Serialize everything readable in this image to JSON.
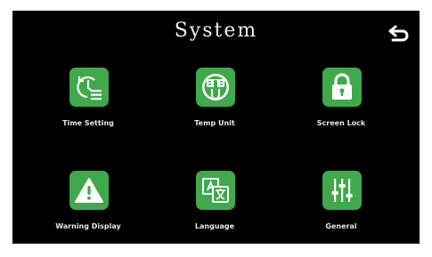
{
  "header": {
    "title": "System"
  },
  "theme": {
    "background": "#000000",
    "accent": "#3fa94b",
    "text": "#ffffff"
  },
  "icons": {
    "back": "back-arrow-icon"
  },
  "tiles": [
    {
      "label": "Time Setting",
      "icon": "clock-list-icon"
    },
    {
      "label": "Temp Unit",
      "icon": "thermometer-icon"
    },
    {
      "label": "Screen Lock",
      "icon": "lock-icon"
    },
    {
      "label": "Warning Display",
      "icon": "warning-icon"
    },
    {
      "label": "Language",
      "icon": "language-icon"
    },
    {
      "label": "General",
      "icon": "sliders-icon"
    }
  ]
}
